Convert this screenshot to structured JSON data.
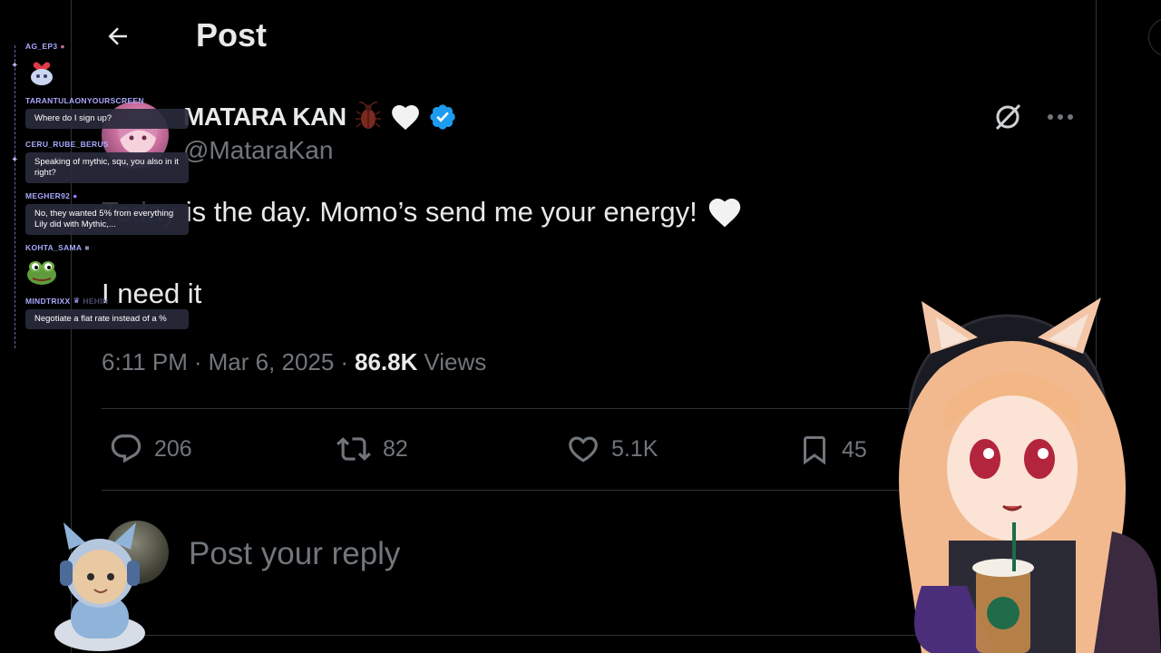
{
  "header": {
    "title": "Post"
  },
  "author": {
    "display_name": "MATARA KAN",
    "handle": "@MataraKan",
    "verified": true
  },
  "tweet": {
    "line1_faded": "Today",
    "line1_rest": "is the day. Momo’s send me your energy!",
    "line2": "I need it"
  },
  "meta": {
    "time": "6:11 PM",
    "sep1": "·",
    "date": "Mar 6, 2025",
    "sep2": "·",
    "views_count": "86.8K",
    "views_label": "Views"
  },
  "actions": {
    "replies": "206",
    "reposts": "82",
    "likes": "5.1K",
    "bookmarks": "45"
  },
  "reply": {
    "placeholder": "Post your reply"
  },
  "chat": {
    "messages": [
      {
        "user": "AG_EP3",
        "text": ""
      },
      {
        "user": "TARANTULAONYOURSCREEN",
        "text": "Where do I sign up?"
      },
      {
        "user": "CERU_RUBE_BERUS",
        "text": "Speaking of mythic, squ, you also in it right?"
      },
      {
        "user": "MEGHER92",
        "text": "No, they wanted 5% from everything Lily did with Mythic,..."
      },
      {
        "user": "KOHTA_SAMA",
        "text": ""
      },
      {
        "user": "MINDTRIXX",
        "badge": "HEHIN",
        "text": "Negotiate a flat rate instead of a %"
      }
    ]
  },
  "colors": {
    "background": "#000000",
    "text_primary": "#e7e9ea",
    "text_secondary": "#71767b",
    "verified_blue": "#1d9bf0",
    "chat_username": "#a9a9ff",
    "divider": "#2f3336"
  },
  "icons": {
    "back": "arrow-left-icon",
    "bug": "cockroach-emoji-icon",
    "heart": "white-heart-emoji-icon",
    "verified": "verified-badge-icon",
    "grok": "grok-icon",
    "more": "more-dots-icon",
    "reply": "reply-icon",
    "repost": "repost-icon",
    "like": "like-icon",
    "bookmark": "bookmark-icon"
  }
}
